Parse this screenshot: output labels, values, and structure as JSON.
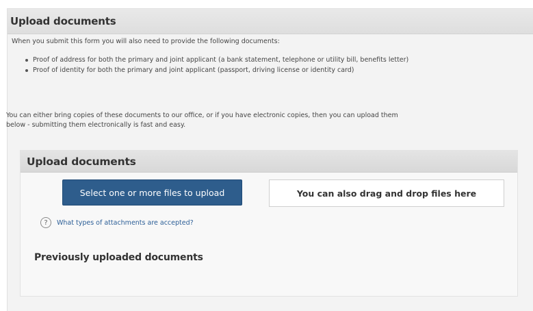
{
  "outer": {
    "title": "Upload documents"
  },
  "intro": "When you submit this form you will also need to provide the following documents:",
  "documents": [
    "Proof of address for both the primary and joint applicant (a bank statement, telephone or utility bill, benefits letter)",
    "Proof of identity for both the primary and joint applicant (passport, driving license or identity card)"
  ],
  "info": {
    "line1": "You can either bring copies of these documents to our office, or if you have electronic copies, then you can upload them",
    "line2": "below - submitting them electronically is fast and easy."
  },
  "upload_panel": {
    "title": "Upload documents",
    "select_button": "Select one or more files to upload",
    "drop_zone": "You can also drag and drop files here",
    "help_icon": "?",
    "help_link": "What types of attachments are accepted?",
    "previous_title": "Previously uploaded documents"
  },
  "icons": {
    "help": "question-circle-icon"
  },
  "colors": {
    "button": "#2e5d8c",
    "link": "#2a5d96"
  }
}
